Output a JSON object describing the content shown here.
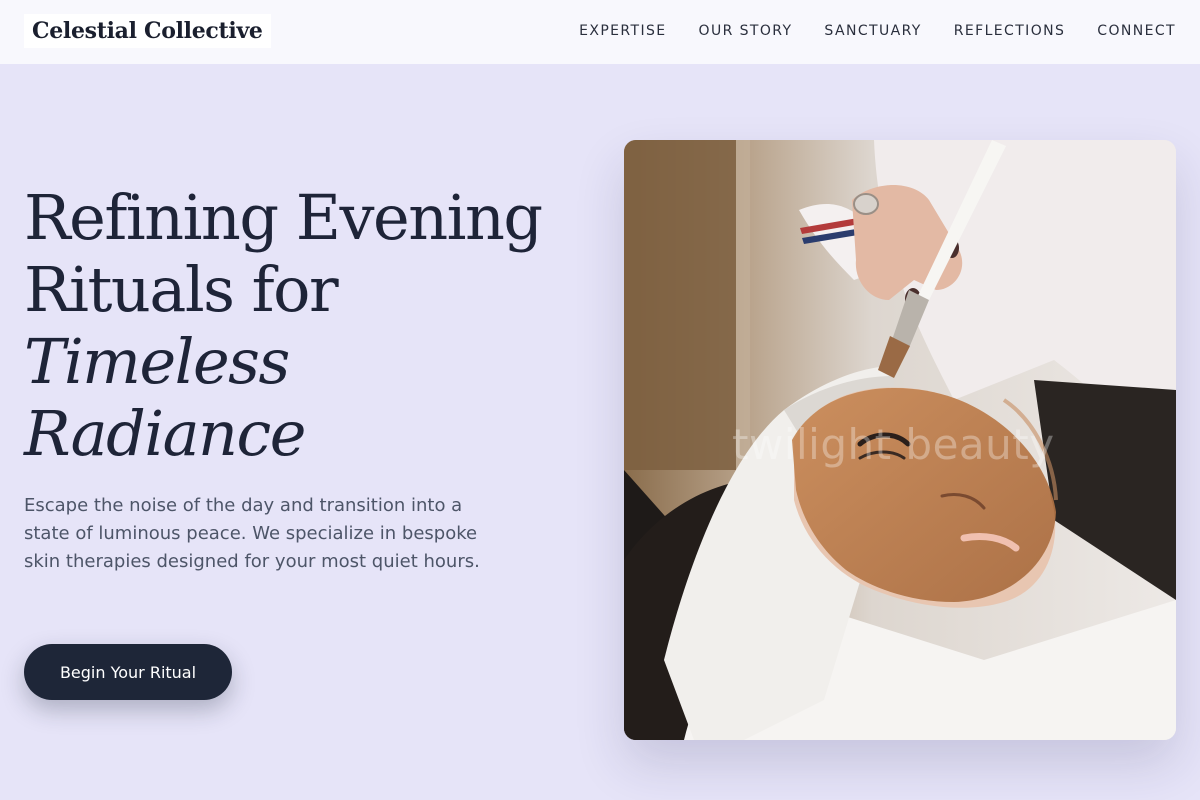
{
  "brand": {
    "name": "Celestial Collective"
  },
  "nav": {
    "items": [
      {
        "label": "EXPERTISE"
      },
      {
        "label": "OUR STORY"
      },
      {
        "label": "SANCTUARY"
      },
      {
        "label": "REFLECTIONS"
      },
      {
        "label": "CONNECT"
      }
    ]
  },
  "hero": {
    "title_line1": "Refining Evening",
    "title_line2": "Rituals for",
    "title_line3": "Timeless",
    "title_line4": "Radiance",
    "description": "Escape the noise of the day and transition into a state of luminous peace. We specialize in bespoke skin therapies designed for your most quiet hours.",
    "cta_label": "Begin Your Ritual",
    "image_watermark": "twilight beauty"
  },
  "colors": {
    "background": "#e6e4f8",
    "header": "#f8f8fd",
    "text_primary": "#1e2438",
    "text_secondary": "#4d5568",
    "button": "#1e2638"
  }
}
